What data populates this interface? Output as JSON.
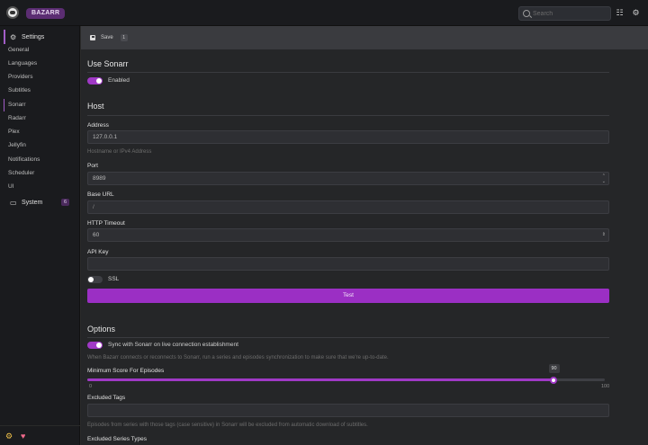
{
  "header": {
    "brand": "BAZARR",
    "search_placeholder": "Search"
  },
  "sidebar": {
    "settings_label": "Settings",
    "items": [
      {
        "label": "General"
      },
      {
        "label": "Languages"
      },
      {
        "label": "Providers"
      },
      {
        "label": "Subtitles"
      },
      {
        "label": "Sonarr"
      },
      {
        "label": "Radarr"
      },
      {
        "label": "Plex"
      },
      {
        "label": "Jellyfin"
      },
      {
        "label": "Notifications"
      },
      {
        "label": "Scheduler"
      },
      {
        "label": "UI"
      }
    ],
    "system_label": "System",
    "system_badge": "6"
  },
  "toolbar": {
    "save_label": "Save",
    "save_count": "1"
  },
  "use_sonarr": {
    "title": "Use Sonarr",
    "enabled_label": "Enabled",
    "enabled": true
  },
  "host": {
    "title": "Host",
    "address_label": "Address",
    "address_value": "127.0.0.1",
    "address_hint": "Hostname or IPv4 Address",
    "port_label": "Port",
    "port_value": "8989",
    "base_url_label": "Base URL",
    "base_url_value": "/",
    "timeout_label": "HTTP Timeout",
    "timeout_value": "60",
    "api_key_label": "API Key",
    "api_key_value": "",
    "ssl_label": "SSL",
    "ssl": false,
    "test_label": "Test"
  },
  "options": {
    "title": "Options",
    "sync_label": "Sync with Sonarr on live connection establishment",
    "sync": true,
    "sync_hint": "When Bazarr connects or reconnects to Sonarr, run a series and episodes synchronization to make sure that we're up-to-date.",
    "min_score_label": "Minimum Score For Episodes",
    "min_score_value": "90",
    "min_score_min": "0",
    "min_score_max": "100",
    "min_score_fraction": 0.9,
    "excluded_tags_label": "Excluded Tags",
    "excluded_tags_hint": "Episodes from series with those tags (case sensitive) in Sonarr will be excluded from automatic download of subtitles.",
    "excluded_series_types_label": "Excluded Series Types"
  },
  "colors": {
    "accent": "#a039c6",
    "brand_bg": "#5b2d72"
  }
}
